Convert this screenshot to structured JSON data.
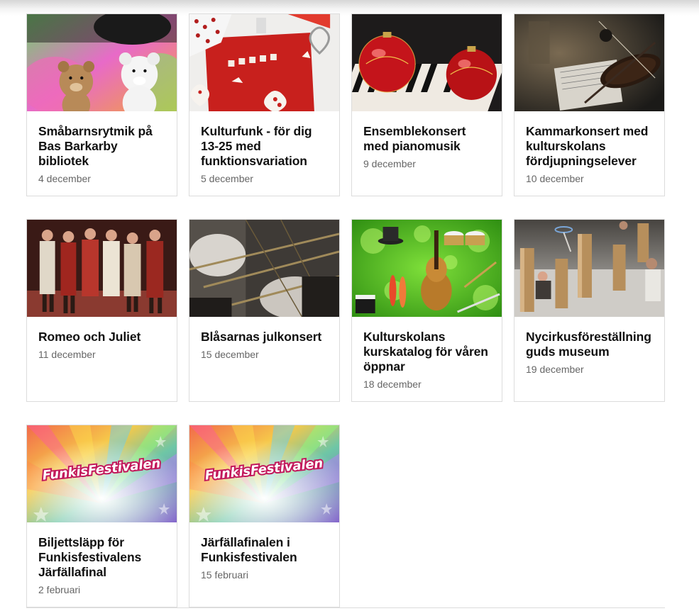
{
  "events": [
    {
      "title": "Småbarnsrytmik på Bas Barkarby bibliotek",
      "date": "4 december",
      "image": "teddy-bears-image"
    },
    {
      "title": "Kulturfunk - för dig 13-25 med funktionsvariation",
      "date": "5 december",
      "image": "baking-hearts-image"
    },
    {
      "title": "Ensemblekonsert med pianomusik",
      "date": "9 december",
      "image": "piano-ornaments-image"
    },
    {
      "title": "Kammarkonsert med kulturskolans fördjupningselever",
      "date": "10 december",
      "image": "violin-image"
    },
    {
      "title": "Romeo och Juliet",
      "date": "11 december",
      "image": "theater-cast-image"
    },
    {
      "title": "Blåsarnas julkonsert",
      "date": "15 december",
      "image": "trombones-image"
    },
    {
      "title": "Kulturskolans kurskatalog för våren öppnar",
      "date": "18 december",
      "image": "instruments-collage-image"
    },
    {
      "title": "Nycirkusföreställning guds museum",
      "date": "19 december",
      "image": "circus-performance-image"
    },
    {
      "title": "Biljettsläpp för Funkisfestivalens Järfällafinal",
      "date": "2 februari",
      "image": "funkisfestivalen-banner-image",
      "logo_text": "FunkisFestivalen"
    },
    {
      "title": "Järfällafinalen i Funkisfestivalen",
      "date": "15 februari",
      "image": "funkisfestivalen-banner-image",
      "logo_text": "FunkisFestivalen"
    }
  ]
}
